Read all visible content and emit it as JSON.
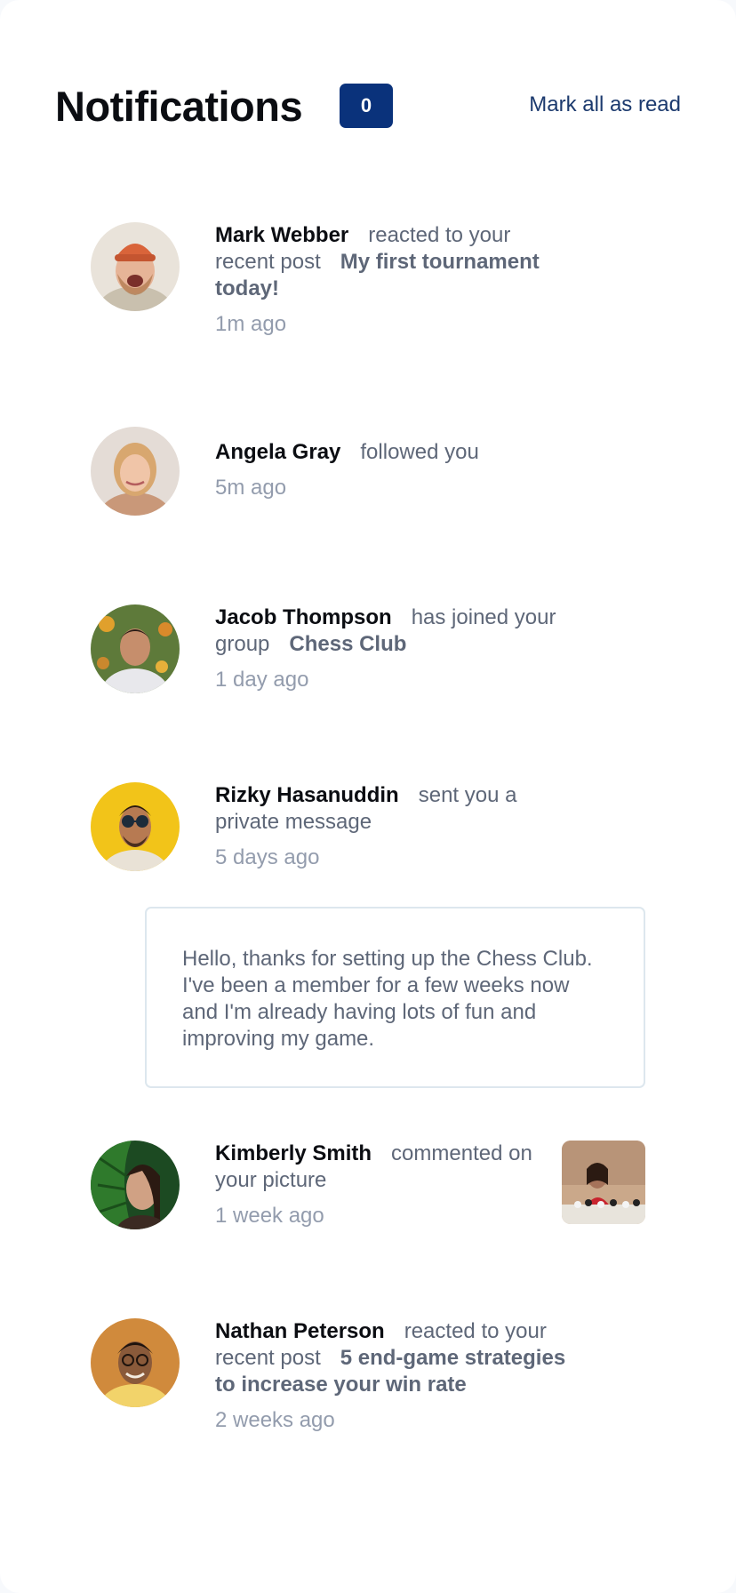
{
  "header": {
    "title": "Notifications",
    "unread_count": "0",
    "mark_all_label": "Mark all as read"
  },
  "colors": {
    "badge": "#0a327b",
    "name": "#0b0d12",
    "text": "#5e6778",
    "time": "#939cad",
    "message_border": "#dde7ee"
  },
  "notifications": [
    {
      "name": "Mark Webber",
      "action": "reacted to your recent post",
      "target": "My first tournament today!",
      "time": "1m ago"
    },
    {
      "name": "Angela Gray",
      "action": "followed you",
      "target": "",
      "time": "5m ago"
    },
    {
      "name": "Jacob Thompson",
      "action": "has joined your group",
      "target": "Chess Club",
      "time": "1 day ago"
    },
    {
      "name": "Rizky Hasanuddin",
      "action": "sent you a private message",
      "target": "",
      "time": "5 days ago",
      "message": "Hello, thanks for setting up the Chess Club. I've been a member for a few weeks now and I'm already having lots of fun and improving my game."
    },
    {
      "name": "Kimberly Smith",
      "action": "commented on your picture",
      "target": "",
      "time": "1 week ago",
      "picture": "chess-picture"
    },
    {
      "name": "Nathan Peterson",
      "action": "reacted to your recent post",
      "target": "5 end-game strategies to increase your win rate",
      "time": "2 weeks ago"
    }
  ]
}
